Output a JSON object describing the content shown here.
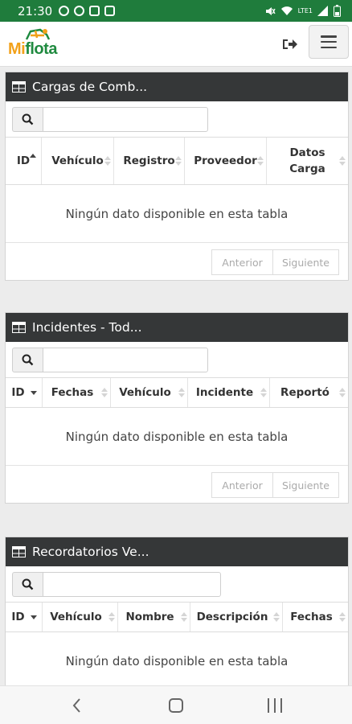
{
  "status_bar": {
    "time": "21:30",
    "right_text": "LTE1"
  },
  "app": {
    "logo_mi": "Mi",
    "logo_flota": "flota",
    "colors": {
      "status_bar": "#1f7c3c",
      "panel_header": "#353738",
      "logo_orange": "#f2a11a",
      "logo_green": "#1f8a3f"
    }
  },
  "icons": [
    "logout-icon",
    "menu-icon",
    "table-icon",
    "search-icon",
    "sort-icon",
    "back-icon",
    "home-icon",
    "recent-apps-icon"
  ],
  "panels": [
    {
      "title": "Cargas de Comb...",
      "search_value": "",
      "columns": [
        "ID",
        "Vehículo",
        "Registro",
        "Proveedor",
        "Datos Carga"
      ],
      "empty_text": "Ningún dato disponible en esta tabla",
      "prev_label": "Anterior",
      "next_label": "Siguiente"
    },
    {
      "title": "Incidentes - Tod...",
      "search_value": "",
      "columns": [
        "ID",
        "Fechas",
        "Vehículo",
        "Incidente",
        "Reportó"
      ],
      "empty_text": "Ningún dato disponible en esta tabla",
      "prev_label": "Anterior",
      "next_label": "Siguiente"
    },
    {
      "title": "Recordatorios Ve...",
      "search_value": "",
      "columns": [
        "ID",
        "Vehículo",
        "Nombre",
        "Descripción",
        "Fechas"
      ],
      "empty_text": "Ningún dato disponible en esta tabla"
    }
  ]
}
